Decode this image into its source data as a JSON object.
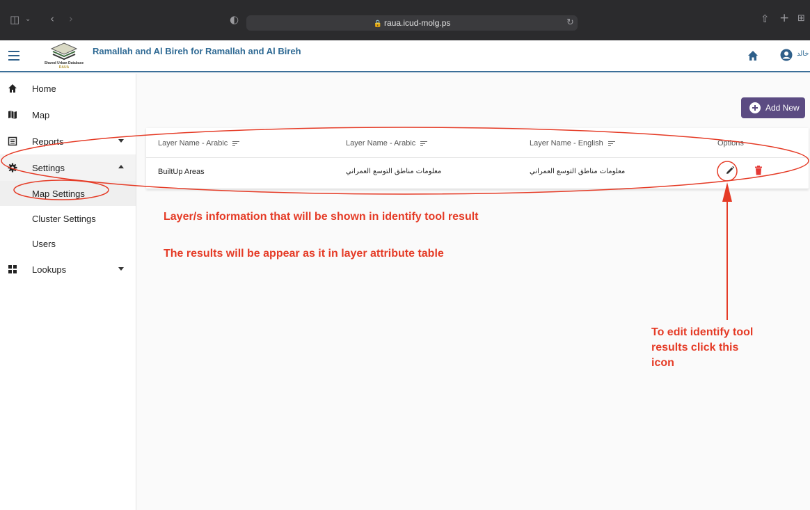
{
  "browser": {
    "url": "raua.icud-molg.ps"
  },
  "header": {
    "title": "Ramallah and Al Bireh for Ramallah and Al Bireh",
    "logo_text": "Shared Urban Database",
    "logo_subtext": "RAUA",
    "language_label": "خالد"
  },
  "sidebar": {
    "items": [
      {
        "label": "Home",
        "icon": "home-icon"
      },
      {
        "label": "Map",
        "icon": "map-icon"
      },
      {
        "label": "Reports",
        "icon": "report-icon"
      },
      {
        "label": "Settings",
        "icon": "gear-icon"
      },
      {
        "label": "Lookups",
        "icon": "grid-icon"
      }
    ],
    "settings_children": [
      {
        "label": "Map Settings"
      },
      {
        "label": "Cluster Settings"
      },
      {
        "label": "Users"
      }
    ]
  },
  "main": {
    "add_button_label": "Add New",
    "table": {
      "headers": [
        "Layer Name - Arabic",
        "Layer Name - Arabic",
        "Layer Name - English",
        "Options"
      ],
      "rows": [
        {
          "col1": "BuiltUp Areas",
          "col2": "معلومات مناطق التوسع العمراني",
          "col3": "معلومات مناطق التوسع العمراني"
        }
      ]
    }
  },
  "annotations": {
    "line1": "Layer/s information that will be shown in identify tool result",
    "line2": "The results will be appear as it in layer attribute table",
    "edit_note": [
      "To edit identify tool",
      "results click this",
      "icon"
    ]
  },
  "colors": {
    "primary": "#2f6a94",
    "accent_button": "#5b4b82",
    "annotation": "#e53b26",
    "delete": "#e53935"
  }
}
